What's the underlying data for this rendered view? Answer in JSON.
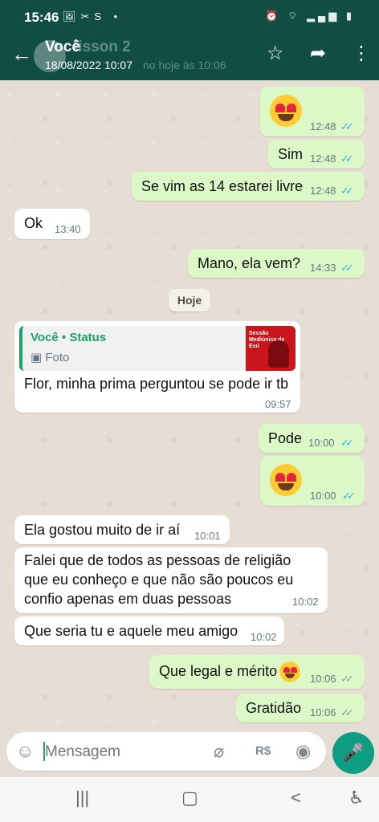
{
  "status_bar": {
    "time": "15:46",
    "left_icons": [
      "image-icon",
      "missed-call-icon",
      "s-app-icon",
      "dot-icon"
    ],
    "right_icons": [
      "alarm-icon",
      "wifi-icon",
      "signal-icon",
      "battery-icon"
    ]
  },
  "header": {
    "title": "Você",
    "subtitle": "18/08/2022 10:07",
    "ghost_name": "lisson 2",
    "ghost_status": "no hoje às 10:06",
    "star_glyph": "☆",
    "forward_glyph": "➦",
    "menu_glyph": "⋮",
    "back_glyph": "←"
  },
  "day_divider": "Hoje",
  "messages": [
    {
      "kind": "out",
      "emoji": true,
      "time": "12:48",
      "ticks": "✓✓"
    },
    {
      "kind": "out",
      "text": "Sim",
      "time": "12:48",
      "ticks": "✓✓"
    },
    {
      "kind": "out",
      "text": "Se vim as 14 estarei livre",
      "time": "12:48",
      "ticks": "✓✓"
    },
    {
      "kind": "in",
      "text": "Ok",
      "time": "13:40"
    },
    {
      "kind": "out",
      "text": "Mano,  ela vem?",
      "time": "14:33",
      "ticks": "✓✓"
    },
    {
      "kind": "in",
      "quoted_author": "Você • Status",
      "quoted_type": "Foto",
      "thumb_text": "Sessão Mediúnica de Exú",
      "text": "Flor, minha prima perguntou se pode ir tb",
      "time": "09:57"
    },
    {
      "kind": "out",
      "text": "Pode",
      "time": "10:00",
      "ticks": "✓✓"
    },
    {
      "kind": "out",
      "emoji": true,
      "time": "10:00",
      "ticks": "✓✓"
    },
    {
      "kind": "in",
      "text": "Ela gostou muito de ir aí",
      "time": "10:01"
    },
    {
      "kind": "in",
      "lines": [
        "Falei que de todos as pessoas de religião",
        "que eu conheço e que não são poucos eu",
        "confio apenas em duas pessoas"
      ],
      "time": "10:02"
    },
    {
      "kind": "in",
      "text": "Que seria tu e aquele meu amigo",
      "time": "10:02"
    },
    {
      "kind": "out",
      "text": "Que legal e mérito",
      "time": "10:06",
      "ticks": "✓✓"
    },
    {
      "kind": "out",
      "text": "Gratidão",
      "time": "10:06",
      "ticks": "✓✓"
    }
  ],
  "input": {
    "placeholder": "Mensagem",
    "emoji_glyph": "☺",
    "attach_glyph": "⌀",
    "currency_glyph": "R$",
    "camera_glyph": "◉",
    "mic_glyph": "🎤"
  },
  "nav": {
    "recents_glyph": "|||",
    "home_glyph": "▢",
    "back_glyph": "<",
    "accessibility_glyph": "♿"
  },
  "colors": {
    "header_bg": "#0f4d45",
    "outgoing_bubble": "#dcf8c6",
    "incoming_bubble": "#ffffff",
    "read_ticks": "#34b7f1",
    "delivered_ticks": "#8c9aa2",
    "accent": "#0e9e84"
  }
}
